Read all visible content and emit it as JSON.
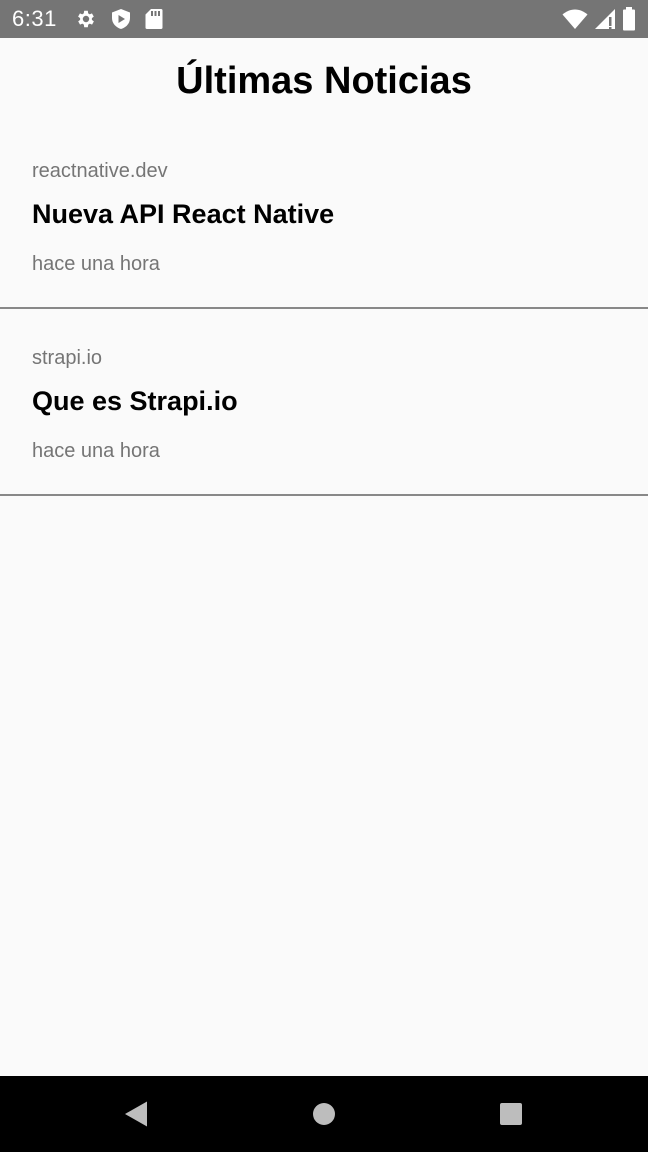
{
  "status_bar": {
    "time": "6:31",
    "left_icons": [
      "gear-icon",
      "shield-icon",
      "sd-card-icon"
    ],
    "right_icons": [
      "wifi-icon",
      "cell-signal-icon",
      "battery-icon"
    ],
    "background": "#757575"
  },
  "header": {
    "title": "Últimas Noticias"
  },
  "news": [
    {
      "source": "reactnative.dev",
      "title": "Nueva API React Native",
      "time": "hace una hora"
    },
    {
      "source": "strapi.io",
      "title": "Que es Strapi.io",
      "time": "hace una hora"
    }
  ],
  "nav_bar": {
    "buttons": [
      "back-icon",
      "home-icon",
      "recents-icon"
    ],
    "background": "#000000"
  }
}
